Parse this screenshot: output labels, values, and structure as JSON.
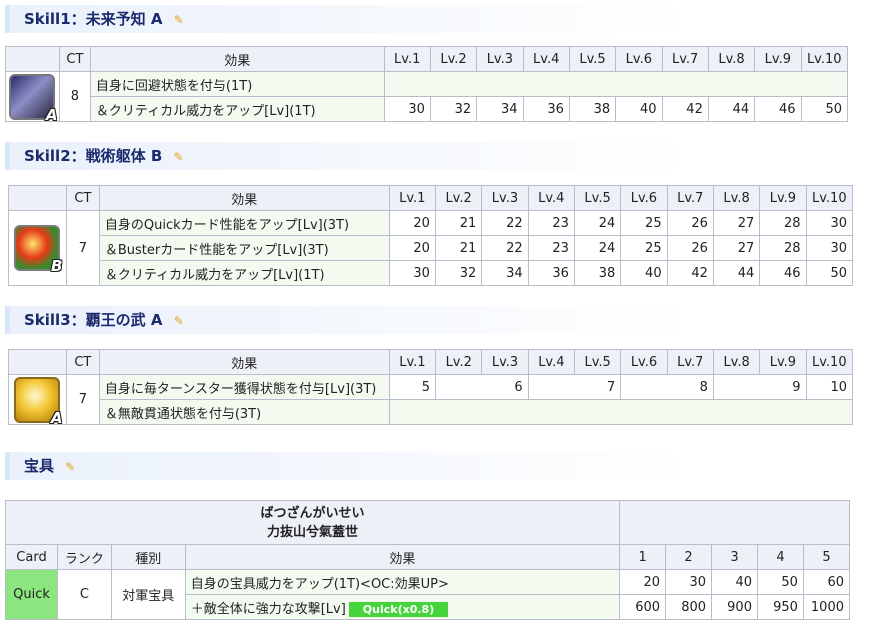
{
  "skill1": {
    "title": "Skill1：未来予知 A",
    "rank": "A",
    "ct": "8",
    "headers": [
      "CT",
      "効果",
      "Lv.1",
      "Lv.2",
      "Lv.3",
      "Lv.4",
      "Lv.5",
      "Lv.6",
      "Lv.7",
      "Lv.8",
      "Lv.9",
      "Lv.10"
    ],
    "effects": [
      "自身に回避状態を付与(1T)",
      "＆クリティカル威力をアップ[Lv](1T)"
    ],
    "values": [
      "30",
      "32",
      "34",
      "36",
      "38",
      "40",
      "42",
      "44",
      "46",
      "50"
    ]
  },
  "skill2": {
    "title": "Skill2：戦術躯体 B",
    "rank": "B",
    "ct": "7",
    "headers": [
      "CT",
      "効果",
      "Lv.1",
      "Lv.2",
      "Lv.3",
      "Lv.4",
      "Lv.5",
      "Lv.6",
      "Lv.7",
      "Lv.8",
      "Lv.9",
      "Lv.10"
    ],
    "effects": [
      "自身のQuickカード性能をアップ[Lv](3T)",
      "＆Busterカード性能をアップ[Lv](3T)",
      "＆クリティカル威力をアップ[Lv](1T)"
    ],
    "rows": [
      [
        "20",
        "21",
        "22",
        "23",
        "24",
        "25",
        "26",
        "27",
        "28",
        "30"
      ],
      [
        "20",
        "21",
        "22",
        "23",
        "24",
        "25",
        "26",
        "27",
        "28",
        "30"
      ],
      [
        "30",
        "32",
        "34",
        "36",
        "38",
        "40",
        "42",
        "44",
        "46",
        "50"
      ]
    ]
  },
  "skill3": {
    "title": "Skill3：覇王の武 A",
    "rank": "A",
    "ct": "7",
    "headers": [
      "CT",
      "効果",
      "Lv.1",
      "Lv.2",
      "Lv.3",
      "Lv.4",
      "Lv.5",
      "Lv.6",
      "Lv.7",
      "Lv.8",
      "Lv.9",
      "Lv.10"
    ],
    "effects": [
      "自身に毎ターンスター獲得状態を付与[Lv](3T)",
      "＆無敵貫通状態を付与(3T)"
    ],
    "values": [
      "5",
      "6",
      "7",
      "8",
      "9",
      "10"
    ]
  },
  "np": {
    "section_title": "宝具",
    "reading": "ばつざんがいせい",
    "name": "力抜山兮氣蓋世",
    "headers": [
      "Card",
      "ランク",
      "種別",
      "効果",
      "1",
      "2",
      "3",
      "4",
      "5"
    ],
    "card": "Quick",
    "rank": "C",
    "type": "対軍宝具",
    "effects": [
      "自身の宝具威力をアップ(1T)<OC:効果UP>",
      "＋敵全体に強力な攻撃[Lv]"
    ],
    "tag": "Quick(x0.8)",
    "rows": [
      [
        "20",
        "30",
        "40",
        "50",
        "60"
      ],
      [
        "600",
        "800",
        "900",
        "950",
        "1000"
      ]
    ]
  },
  "colors": {
    "quick": "#46d43c",
    "header_text": "#1a2a6c",
    "effect_bg": "#f3faef"
  }
}
